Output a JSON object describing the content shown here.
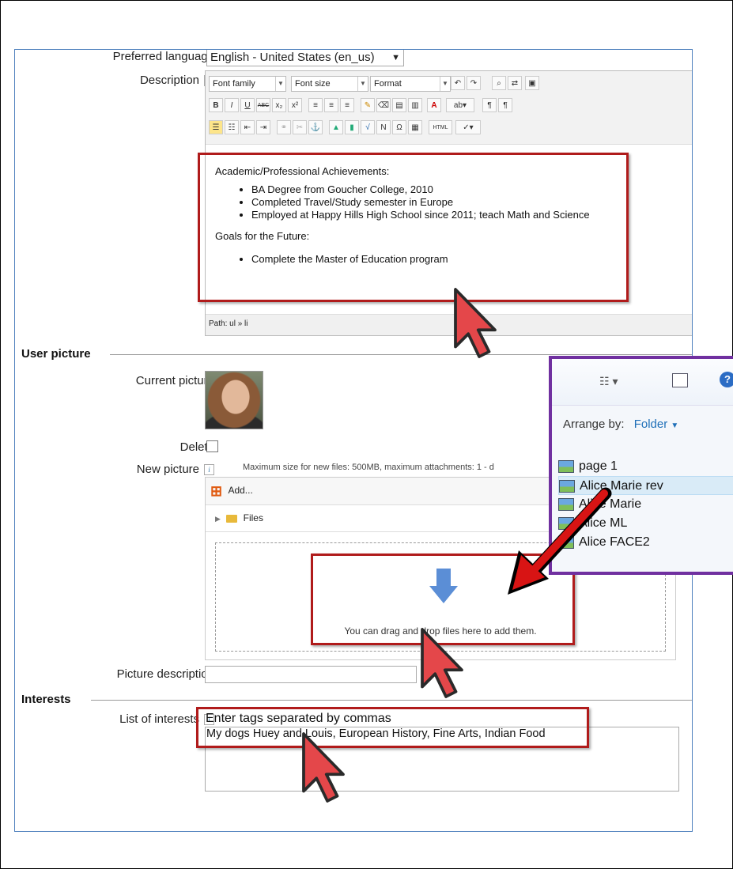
{
  "profile": {
    "preferred_language_label": "Preferred language",
    "preferred_language_value": "English - United States (en_us)",
    "description_label": "Description",
    "editor": {
      "font_family": "Font family",
      "font_size": "Font size",
      "format": "Format",
      "heading": "Academic/Professional Achievements:",
      "achievements": [
        "BA Degree from Goucher College, 2010",
        "Completed Travel/Study semester in Europe",
        "Employed at Happy Hills High School since 2011; teach Math and Science"
      ],
      "goals_heading": "Goals for the Future:",
      "goals": [
        "Complete the Master of Education program"
      ],
      "path": "Path: ul » li"
    }
  },
  "user_picture": {
    "section_title": "User picture",
    "current_picture_label": "Current picture",
    "delete_label": "Delete",
    "new_picture_label": "New picture",
    "max_size_note": "Maximum size for new files: 500MB, maximum attachments: 1 - d",
    "add_label": "Add...",
    "files_label": "Files",
    "drop_text": "You can drag and drop files here to add them.",
    "picture_description_label": "Picture description"
  },
  "interests": {
    "section_title": "Interests",
    "list_label": "List of interests",
    "hint": "Enter tags separated by commas",
    "value": "My dogs Huey and Louis, European History, Fine Arts, Indian Food"
  },
  "explorer": {
    "arrange_by_label": "Arrange by:",
    "arrange_by_value": "Folder",
    "files": [
      "page 1",
      "Alice Marie rev",
      "Alice Marie",
      "Alice ML",
      "Alice FACE2"
    ],
    "selected_index": 1
  },
  "colors": {
    "panel_border": "#4f81bd",
    "highlight_box": "#b01b1b",
    "popup_border": "#7030a0",
    "arrow": "#d81414",
    "link": "#1e6fb8"
  }
}
